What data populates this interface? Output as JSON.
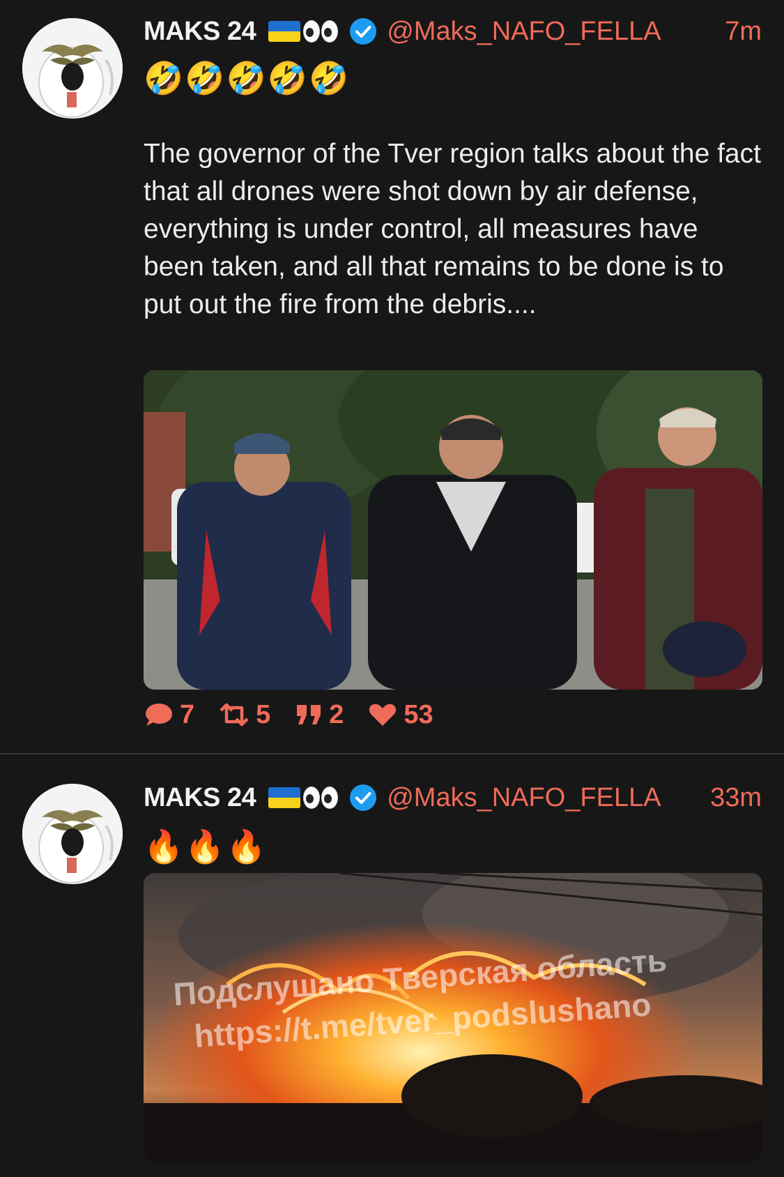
{
  "tweets": [
    {
      "display_name": "MAKS 24",
      "handle": "@Maks_NAFO_FELLA",
      "time": "7m",
      "emojis": [
        "🤣",
        "🤣",
        "🤣",
        "🤣",
        "🤣"
      ],
      "text": "The governor of the Tver region talks about the fact that all drones were shot down by air defense, everything is under control, all measures have been taken, and all that remains to be done is to put out the fire from the debris....",
      "stats": {
        "replies": "7",
        "retweets": "5",
        "quotes": "2",
        "likes": "53"
      }
    },
    {
      "display_name": "MAKS 24",
      "handle": "@Maks_NAFO_FELLA",
      "time": "33m",
      "emojis": [
        "🔥",
        "🔥",
        "🔥"
      ],
      "media_watermark": {
        "line1": "Подслушано Тверская область",
        "line2": "https://t.me/tver_podslushano"
      }
    }
  ],
  "icons": {
    "reply": "speech-bubble-icon",
    "retweet": "retweet-icon",
    "quote": "quote-icon",
    "like": "heart-icon",
    "verified": "verified-check-icon"
  },
  "colors": {
    "background": "#171717",
    "accent": "#f06b5a",
    "verified": "#1d9bf0",
    "text": "#ededed"
  }
}
